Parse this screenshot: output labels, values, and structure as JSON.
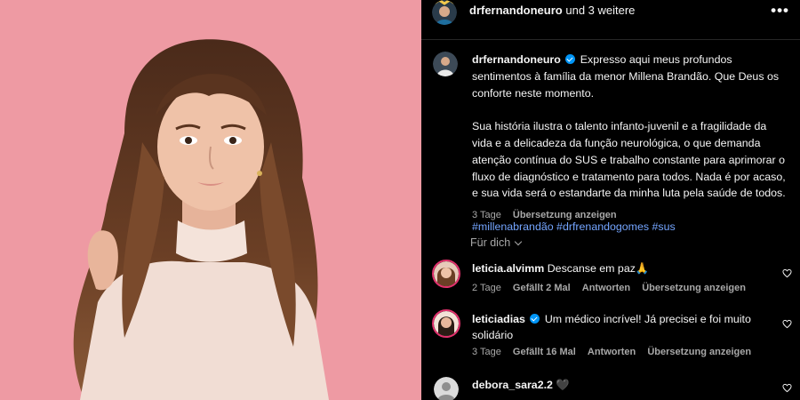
{
  "post": {
    "header": {
      "author": "drfernandoneuro",
      "others": "und 3 weitere",
      "more_icon": "more-horizontal-icon"
    },
    "caption": {
      "username": "drfernandoneuro",
      "text_1": "Expresso aqui meus profundos sentimentos à família da menor Millena Brandão. Que Deus os conforte neste momento.",
      "text_2": "Sua história ilustra o talento infanto-juvenil e a fragilidade da vida e a delicadeza da função neurológica, o que demanda atenção contínua do SUS e trabalho constante para aprimorar o fluxo de diagnóstico e tratamento para todos. Nada é por acaso, e sua vida será o estandarte da minha luta pela saúde de todos.",
      "hashtags": "#millenabrandão #drfrenandogomes #sus",
      "time": "3 Tage",
      "translate": "Übersetzung anzeigen"
    },
    "fuer_dich": "Für dich"
  },
  "comments": [
    {
      "username": "leticia.alvimm",
      "verified": false,
      "text": "Descanse em paz🙏",
      "time": "2 Tage",
      "likes": "Gefällt 2 Mal",
      "reply": "Antworten",
      "translate": "Übersetzung anzeigen"
    },
    {
      "username": "leticiadias",
      "verified": true,
      "text": "Um médico incrível! Já precisei e foi muito solidário",
      "time": "3 Tage",
      "likes": "Gefällt 16 Mal",
      "reply": "Antworten",
      "translate": "Übersetzung anzeigen"
    },
    {
      "username": "debora_sara2.2",
      "verified": false,
      "text": "🖤"
    }
  ],
  "colors": {
    "photo_background": "#ee9aa3",
    "hashtag_blue": "#74a5ff",
    "verified_blue": "#0095f6",
    "muted_text": "#a8a8a8"
  }
}
